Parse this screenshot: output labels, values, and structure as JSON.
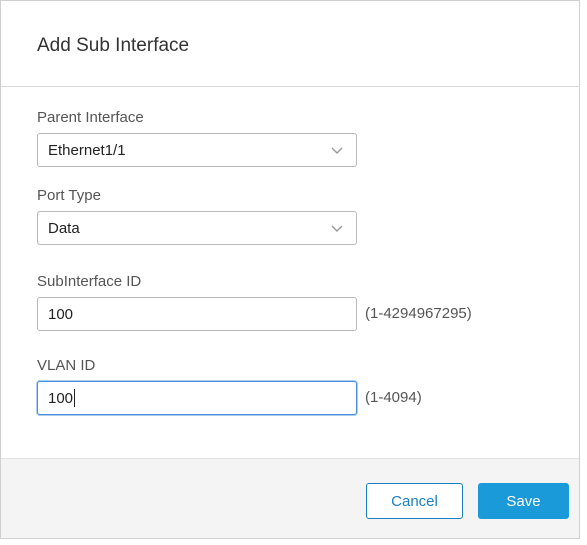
{
  "dialog": {
    "title": "Add Sub Interface"
  },
  "form": {
    "parent_interface": {
      "label": "Parent Interface",
      "value": "Ethernet1/1",
      "icon": "chevron-down-icon"
    },
    "port_type": {
      "label": "Port Type",
      "value": "Data",
      "icon": "chevron-down-icon"
    },
    "subinterface_id": {
      "label": "SubInterface ID",
      "value": "100",
      "range": "(1-4294967295)"
    },
    "vlan_id": {
      "label": "VLAN ID",
      "value": "100",
      "range": "(1-4094)"
    }
  },
  "footer": {
    "cancel_label": "Cancel",
    "save_label": "Save"
  },
  "colors": {
    "primary": "#1a9ad9",
    "focus_border": "#4a90d9",
    "footer_bg": "#f4f4f4"
  }
}
